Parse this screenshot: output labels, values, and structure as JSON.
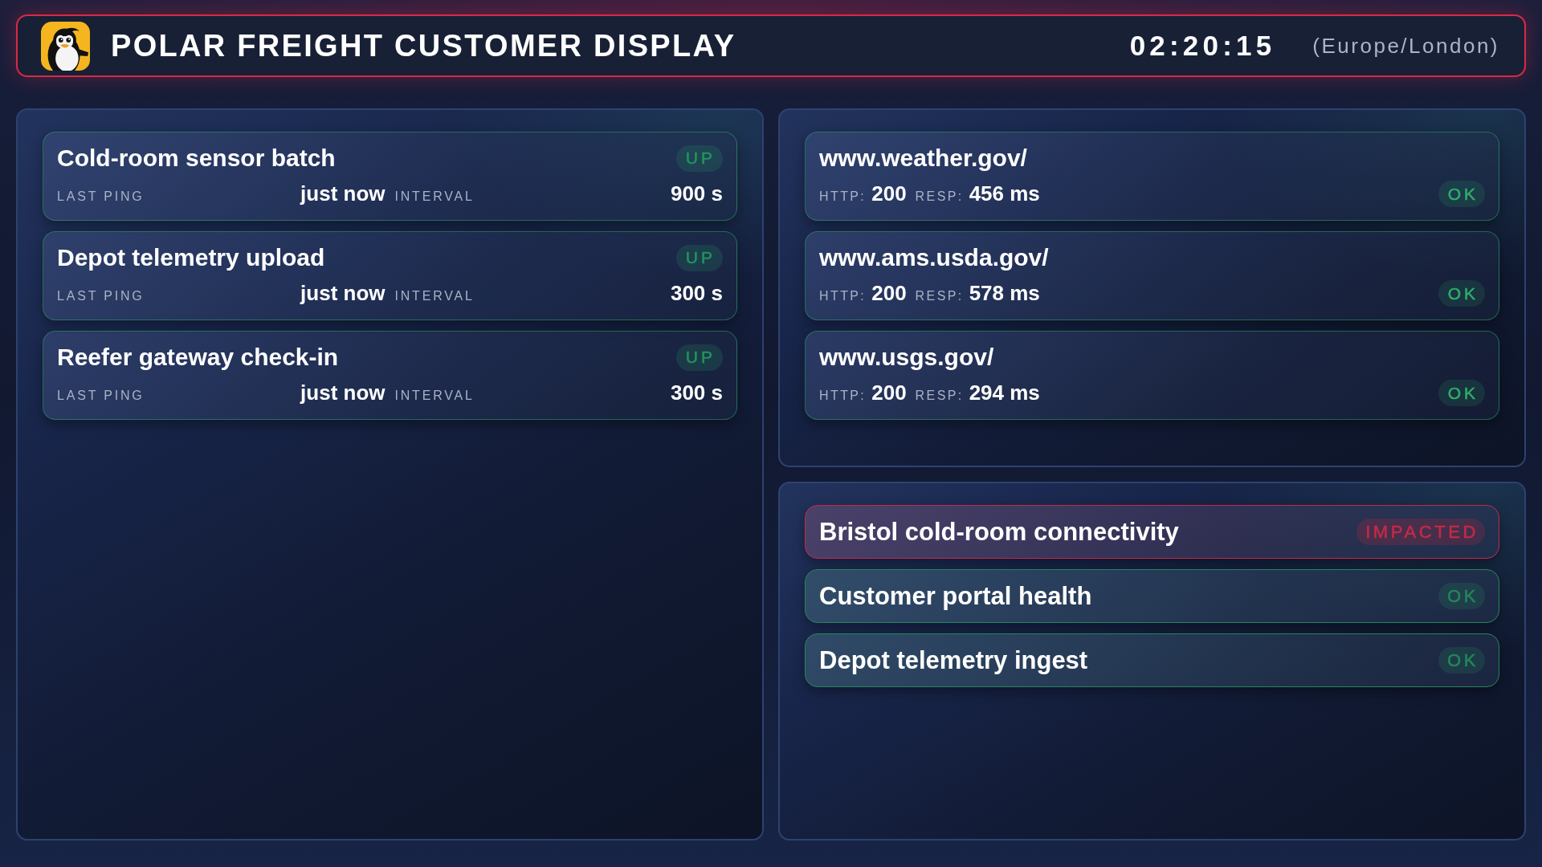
{
  "header": {
    "title": "POLAR FREIGHT CUSTOMER DISPLAY",
    "clock": "02:20:15",
    "timezone": "(Europe/London)"
  },
  "heartbeats": [
    {
      "name": "Cold-room sensor batch",
      "status": "UP",
      "last_ping_label": "LAST PING",
      "last_ping": "just now",
      "interval_label": "INTERVAL",
      "interval": "900 s"
    },
    {
      "name": "Depot telemetry upload",
      "status": "UP",
      "last_ping_label": "LAST PING",
      "last_ping": "just now",
      "interval_label": "INTERVAL",
      "interval": "300 s"
    },
    {
      "name": "Reefer gateway check-in",
      "status": "UP",
      "last_ping_label": "LAST PING",
      "last_ping": "just now",
      "interval_label": "INTERVAL",
      "interval": "300 s"
    }
  ],
  "endpoints": [
    {
      "url": "www.weather.gov/",
      "http_label": "HTTP:",
      "http_code": "200",
      "resp_label": "RESP:",
      "response_time": "456 ms",
      "status": "OK"
    },
    {
      "url": "www.ams.usda.gov/",
      "http_label": "HTTP:",
      "http_code": "200",
      "resp_label": "RESP:",
      "response_time": "578 ms",
      "status": "OK"
    },
    {
      "url": "www.usgs.gov/",
      "http_label": "HTTP:",
      "http_code": "200",
      "resp_label": "RESP:",
      "response_time": "294 ms",
      "status": "OK"
    }
  ],
  "services": [
    {
      "name": "Bristol cold-room connectivity",
      "status": "IMPACTED",
      "color": "#c42a46"
    },
    {
      "name": "Customer portal health",
      "status": "OK",
      "color": "#24865a"
    },
    {
      "name": "Depot telemetry ingest",
      "status": "OK",
      "color": "#24865a"
    }
  ]
}
